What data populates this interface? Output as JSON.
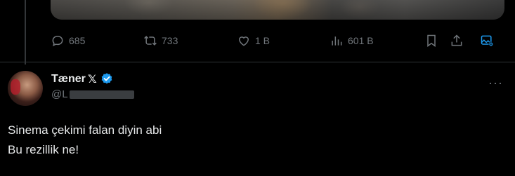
{
  "colors": {
    "background": "#000000",
    "text_primary": "#e7e9ea",
    "text_secondary": "#71767b",
    "accent": "#1d9bf0",
    "divider": "#2f3336"
  },
  "action_bar": {
    "replies": {
      "icon": "reply-icon",
      "count": "685"
    },
    "reposts": {
      "icon": "repost-icon",
      "count": "733"
    },
    "likes": {
      "icon": "heart-icon",
      "count": "1 B"
    },
    "views": {
      "icon": "views-icon",
      "count": "601 B"
    },
    "bookmark": {
      "icon": "bookmark-icon"
    },
    "share": {
      "icon": "share-icon"
    },
    "media": {
      "icon": "image-icon"
    }
  },
  "reply_tweet": {
    "author_name": "Tæner",
    "author_suffix": "𝕏",
    "handle": "@L",
    "more_label": "···",
    "text_lines": [
      "Sinema çekimi falan diyin abi",
      "Bu rezillik ne!"
    ]
  }
}
